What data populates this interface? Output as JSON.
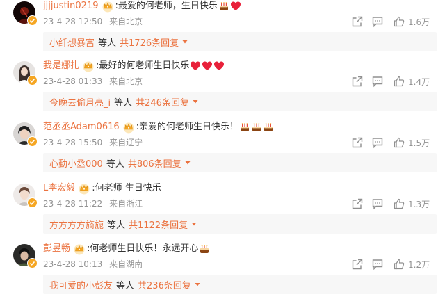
{
  "colors": {
    "accent": "#eb7340",
    "text": "#333333",
    "muted": "#939393",
    "reply_bg": "#f7f7f7",
    "badge": "#f5a623"
  },
  "icons": {
    "share": "share-out-icon",
    "reply": "comment-bubble-icon",
    "like": "thumbs-up-icon",
    "crown": "vip-crown-icon",
    "cake": "birthday-cake-emoji",
    "heart": "red-heart-emoji",
    "caret": "caret-down-icon"
  },
  "comments": [
    {
      "username": "jjjjustin0219",
      "text": ":最爱的何老师，生日快乐",
      "emoji": [
        "cake",
        "heart"
      ],
      "time": "23-4-28 12:50",
      "location": "来自北京",
      "likes": "1.6万",
      "reply_user": "小纤想暴富",
      "reply_etc": "等人",
      "reply_count": "共1726条回复"
    },
    {
      "username": "我是娜扎",
      "text": ":最好的何老师生日快乐",
      "emoji": [
        "heart",
        "heart",
        "heart"
      ],
      "time": "23-4-28 01:33",
      "location": "来自北京",
      "likes": "1.4万",
      "reply_user": "今晚去偷月亮_i",
      "reply_etc": "等人",
      "reply_count": "共246条回复"
    },
    {
      "username": "范丞丞Adam0616",
      "text": ":亲爱的何老师生日快乐！",
      "emoji": [
        "cake",
        "cake",
        "cake"
      ],
      "time": "23-4-28 15:50",
      "location": "来自辽宁",
      "likes": "1.5万",
      "reply_user": "心動小丞000",
      "reply_etc": "等人",
      "reply_count": "共806条回复"
    },
    {
      "username": "L李宏毅",
      "text": ":何老师 生日快乐",
      "emoji": [],
      "time": "23-4-28 11:22",
      "location": "来自浙江",
      "likes": "1.3万",
      "reply_user": "方方方方旖旎",
      "reply_etc": "等人",
      "reply_count": "共1122条回复"
    },
    {
      "username": "彭昱畅",
      "text": ":何老师生日快乐！永远开心",
      "emoji": [
        "cake"
      ],
      "time": "23-4-28 10:13",
      "location": "来自湖南",
      "likes": "1.2万",
      "reply_user": "我可爱的小彭友",
      "reply_etc": "等人",
      "reply_count": "共236条回复"
    }
  ]
}
